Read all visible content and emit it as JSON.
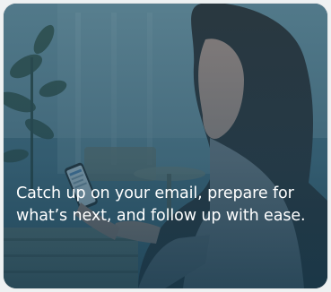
{
  "card": {
    "caption": "Catch up on your email, prepare for what’s next, and follow up with ease."
  },
  "colors": {
    "tint": "#2f5e73",
    "caption_text": "#ffffff"
  }
}
